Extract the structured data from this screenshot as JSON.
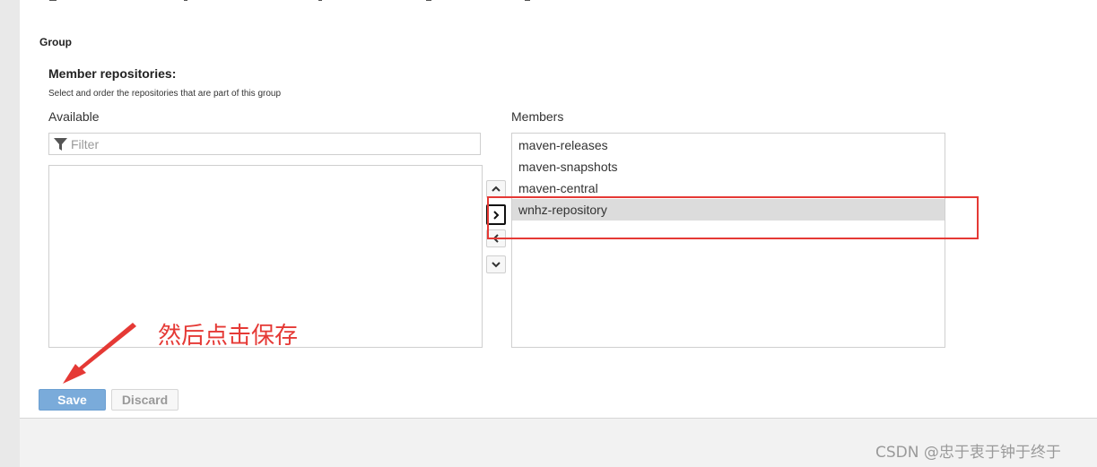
{
  "form": {
    "section_title": "Group",
    "field_label": "Member repositories:",
    "field_help": "Select and order the repositories that are part of this group",
    "available": {
      "heading": "Available",
      "filter_placeholder": "Filter",
      "items": []
    },
    "members": {
      "heading": "Members",
      "items": [
        {
          "label": "maven-releases",
          "selected": false
        },
        {
          "label": "maven-snapshots",
          "selected": false
        },
        {
          "label": "maven-central",
          "selected": false
        },
        {
          "label": "wnhz-repository",
          "selected": true
        }
      ]
    },
    "controls": {
      "move_up": "chevron-up-icon",
      "add": "chevron-right-icon",
      "remove": "chevron-left-icon",
      "move_down": "chevron-down-icon"
    },
    "buttons": {
      "save_label": "Save",
      "discard_label": "Discard"
    }
  },
  "overlay": {
    "annotation_text": "然后点击保存",
    "annotation_color": "#e53935",
    "watermark": "CSDN @忠于衷于钟于终于"
  },
  "colors": {
    "save_button": "#7aabda",
    "selected_row": "#dcdcdc",
    "highlight": "#e53935"
  }
}
